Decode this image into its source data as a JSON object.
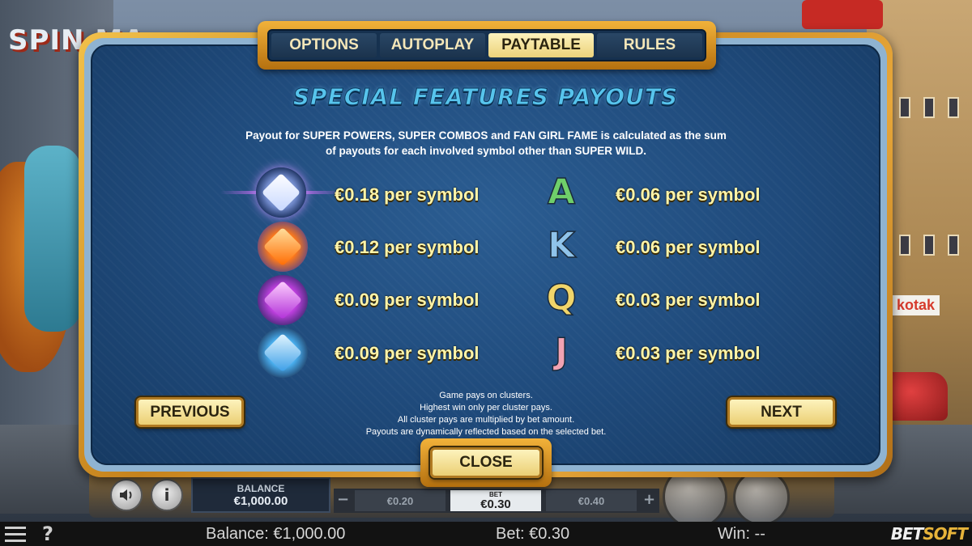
{
  "background": {
    "game_logo_text": "SPIN MA",
    "street_sign": "kotak"
  },
  "tabs": [
    {
      "label": "OPTIONS",
      "active": false
    },
    {
      "label": "AUTOPLAY",
      "active": false
    },
    {
      "label": "PAYTABLE",
      "active": true
    },
    {
      "label": "RULES",
      "active": false
    }
  ],
  "paytable": {
    "title": "SPECIAL FEATURES PAYOUTS",
    "description_line1": "Payout for SUPER POWERS, SUPER COMBOS and FAN GIRL FAME is calculated as the sum",
    "description_line2": "of payouts for each involved symbol other than SUPER WILD.",
    "left_rows": [
      {
        "icon": "white-crystal-icon",
        "payout": "€0.18 per symbol",
        "color": "#e9f1ff"
      },
      {
        "icon": "orange-crystal-icon",
        "payout": "€0.12 per symbol",
        "color": "#ff8a1e"
      },
      {
        "icon": "purple-crystal-icon",
        "payout": "€0.09 per symbol",
        "color": "#c64fe0"
      },
      {
        "icon": "blue-crystal-icon",
        "payout": "€0.09 per symbol",
        "color": "#57b7f3"
      }
    ],
    "right_rows": [
      {
        "letter": "A",
        "payout": "€0.06 per symbol",
        "color": "#6fcf6a"
      },
      {
        "letter": "K",
        "payout": "€0.06 per symbol",
        "color": "#8fc3ea"
      },
      {
        "letter": "Q",
        "payout": "€0.03 per symbol",
        "color": "#f1d56a"
      },
      {
        "letter": "J",
        "payout": "€0.03 per symbol",
        "color": "#f2a3b3"
      }
    ],
    "notes": [
      "Game pays on clusters.",
      "Highest win only per cluster pays.",
      "All cluster pays are multiplied by bet amount.",
      "Payouts are dynamically reflected based on the selected bet."
    ],
    "previous_label": "PREVIOUS",
    "next_label": "NEXT",
    "close_label": "CLOSE"
  },
  "controls": {
    "balance_label": "BALANCE",
    "balance_value": "€1,000.00",
    "bet_minus": "−",
    "bet_plus": "+",
    "bet_prev": "€0.20",
    "bet_label": "BET",
    "bet_value": "€0.30",
    "bet_next": "€0.40",
    "info_glyph": "i"
  },
  "status_bar": {
    "balance": "Balance: €1,000.00",
    "bet": "Bet: €0.30",
    "win": "Win: --",
    "help_glyph": "?",
    "brand_a": "BET",
    "brand_b": "SOFT"
  }
}
